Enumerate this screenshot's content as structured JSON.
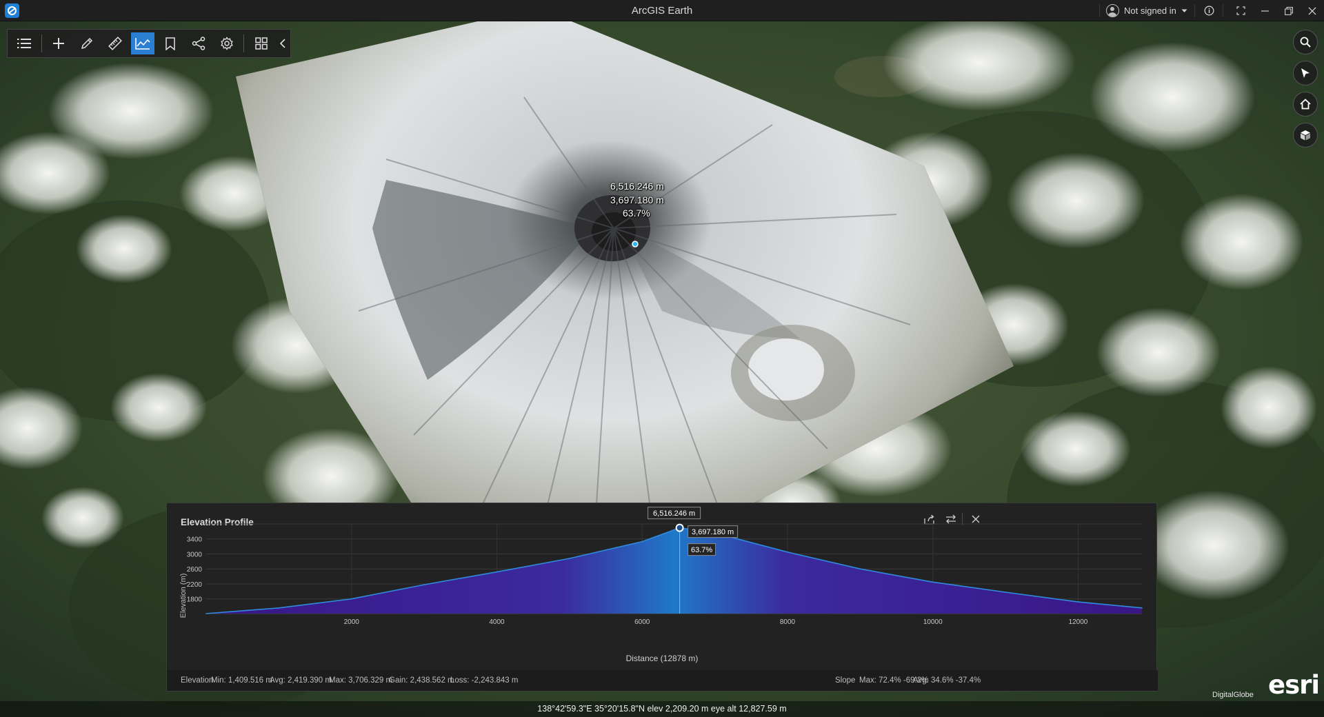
{
  "titlebar": {
    "title": "ArcGIS Earth",
    "signin_label": "Not signed in"
  },
  "toolbar": {
    "tools": [
      "layers-list",
      "add-data",
      "draw",
      "measure",
      "elevation-profile",
      "bookmark",
      "share",
      "settings",
      "toolbox",
      "collapse"
    ],
    "active_tool": "elevation-profile"
  },
  "nav": {
    "buttons": [
      "search",
      "navigate",
      "home",
      "3d-view"
    ]
  },
  "map_labels": {
    "distance": "6,516.246 m",
    "elevation": "3,697.180 m",
    "percent": "63.7%"
  },
  "elevation_profile": {
    "title": "Elevation Profile",
    "tooltip_distance": "6,516.246 m",
    "tooltip_elevation": "3,697.180 m",
    "tooltip_percent": "63.7%",
    "stats": {
      "elevation_label": "Elevation",
      "min": "Min: 1,409.516 m",
      "avg": "Avg: 2,419.390 m",
      "max": "Max: 3,706.329 m",
      "gain": "Gain: 2,438.562 m",
      "loss": "Loss: -2,243.843 m",
      "slope_label": "Slope",
      "slope_max": "Max: 72.4%  -69.2%",
      "slope_avg": "Avg: 34.6%  -37.4%"
    }
  },
  "chart_data": {
    "type": "area",
    "xlabel": "Distance (12878 m)",
    "ylabel": "Elevation (m)",
    "xlim": [
      0,
      12878
    ],
    "ylim": [
      1409,
      3800
    ],
    "xticks": [
      2000,
      4000,
      6000,
      8000,
      10000,
      12000
    ],
    "yticks": [
      1800,
      2200,
      2600,
      3000,
      3400
    ],
    "x": [
      0,
      1000,
      2000,
      3000,
      4000,
      5000,
      6000,
      6516,
      7000,
      8000,
      9000,
      10000,
      11000,
      12000,
      12878
    ],
    "y": [
      1409,
      1560,
      1800,
      2180,
      2520,
      2880,
      3330,
      3697,
      3560,
      3050,
      2600,
      2250,
      1980,
      1720,
      1560
    ],
    "marker": {
      "x": 6516,
      "y": 3697
    },
    "grid": true,
    "colors": {
      "low": "#3b1a8a",
      "peak": "#1f7ad0",
      "line": "#2f8be0"
    }
  },
  "status": {
    "text": "138°42'59.3\"E 35°20'15.8\"N   elev 2,209.20 m    eye alt 12,827.59 m",
    "credit": "DigitalGlobe",
    "logo": "esri"
  }
}
